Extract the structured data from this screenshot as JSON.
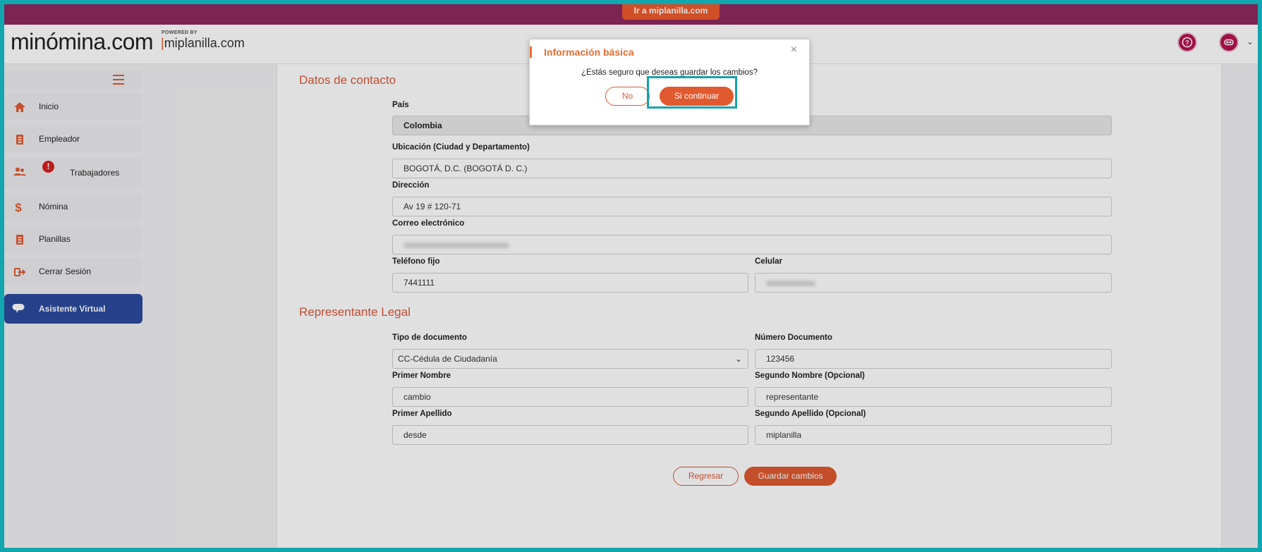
{
  "topbar": {
    "link_label": "Ir a miplanilla.com"
  },
  "header": {
    "logo_main": "minómina.com",
    "logo_powered": "POWERED BY",
    "logo_sub_bar": "|",
    "logo_sub": "miplanilla.com",
    "help_icon": "help-circle-icon",
    "user_icon": "user-avatar-icon"
  },
  "sidebar": {
    "items": [
      {
        "label": "Inicio",
        "icon": "home-icon"
      },
      {
        "label": "Empleador",
        "icon": "document-icon"
      },
      {
        "label": "Trabajadores",
        "icon": "users-icon",
        "badge": "!"
      },
      {
        "label": "Nómina",
        "icon": "dollar-icon"
      },
      {
        "label": "Planillas",
        "icon": "document-icon"
      },
      {
        "label": "Cerrar Sesión",
        "icon": "logout-icon"
      },
      {
        "label": "Asistente Virtual",
        "icon": "chat-icon"
      }
    ]
  },
  "form": {
    "contact_title": "Datos de contacto",
    "pais_label": "País",
    "pais_value": "Colombia",
    "ubicacion_label": "Ubicación (Ciudad y Departamento)",
    "ubicacion_value": "BOGOTÁ, D.C. (BOGOTÁ  D. C.)",
    "direccion_label": "Dirección",
    "direccion_value": "Av 19 # 120-71",
    "correo_label": "Correo electrónico",
    "telefono_label": "Teléfono fijo",
    "telefono_value": "7441111",
    "celular_label": "Celular",
    "rep_title": "Representante Legal",
    "tipo_doc_label": "Tipo de documento",
    "tipo_doc_value": "CC-Cédula de Ciudadanía",
    "num_doc_label": "Número Documento",
    "num_doc_value": "123456",
    "primer_nombre_label": "Primer Nombre",
    "primer_nombre_value": "cambio",
    "segundo_nombre_label": "Segundo Nombre (Opcional)",
    "segundo_nombre_value": "representante",
    "primer_apellido_label": "Primer Apellido",
    "primer_apellido_value": "desde",
    "segundo_apellido_label": "Segundo Apellido (Opcional)",
    "segundo_apellido_value": "miplanilla",
    "back_label": "Regresar",
    "save_label": "Guardar cambios"
  },
  "modal": {
    "title": "Información básica",
    "close": "×",
    "message": "¿Estás seguro que deseas guardar los cambios?",
    "no_label": "No",
    "yes_label": "Si continuar"
  },
  "colors": {
    "brand_purple": "#8f2a5e",
    "brand_orange": "#e0592f",
    "active_nav": "#2c4a9c",
    "highlight": "#14a3ad"
  }
}
